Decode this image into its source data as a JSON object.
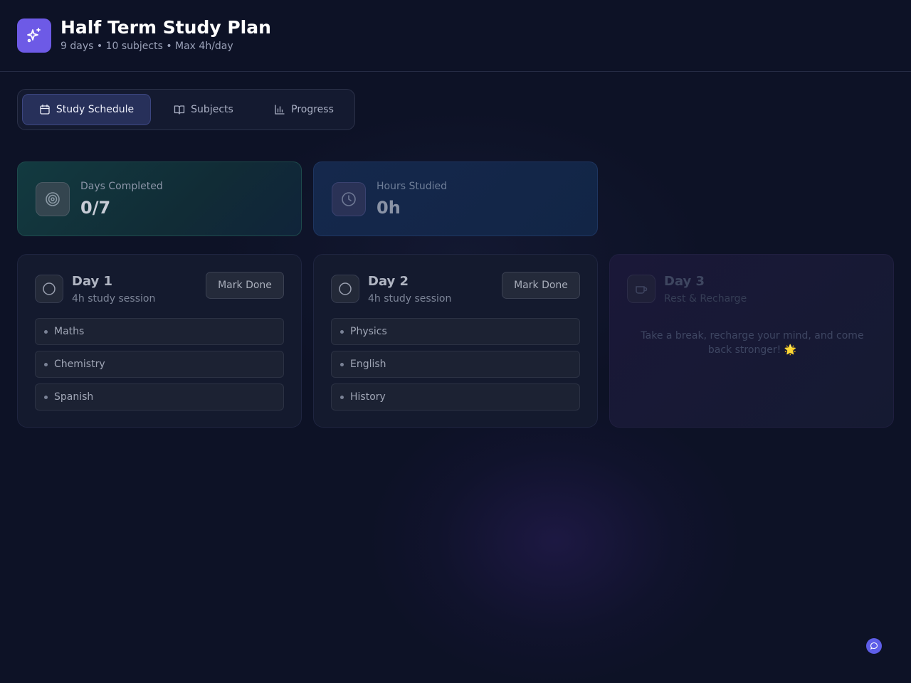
{
  "header": {
    "title": "Half Term Study Plan",
    "subtitle": "9 days • 10 subjects • Max 4h/day",
    "logo_icon": "sparkles-icon"
  },
  "tabs": [
    {
      "label": "Study Schedule",
      "icon": "calendar-icon",
      "active": true
    },
    {
      "label": "Subjects",
      "icon": "book-open-icon",
      "active": false
    },
    {
      "label": "Progress",
      "icon": "bar-chart-icon",
      "active": false
    }
  ],
  "stats": [
    {
      "label": "Days Completed",
      "value": "0/7",
      "icon": "target-icon"
    },
    {
      "label": "Hours Studied",
      "value": "0h",
      "icon": "clock-icon"
    }
  ],
  "days": [
    {
      "title": "Day 1",
      "subtitle": "4h study session",
      "button": "Mark Done",
      "subjects": [
        "Maths",
        "Chemistry",
        "Spanish"
      ]
    },
    {
      "title": "Day 2",
      "subtitle": "4h study session",
      "button": "Mark Done",
      "subjects": [
        "Physics",
        "English",
        "History"
      ]
    },
    {
      "title": "Day 3",
      "subtitle": "Rest & Recharge",
      "message": "Take a break, recharge your mind, and come back stronger! 🌟",
      "icon": "coffee-icon"
    }
  ],
  "colors": {
    "background": "#0d1226",
    "accent": "#6d5ae6",
    "active_tab": "#27305a"
  }
}
